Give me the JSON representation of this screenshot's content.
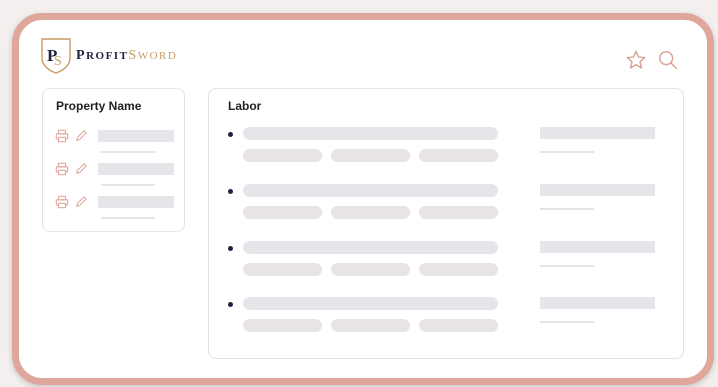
{
  "brand": {
    "logo_monogram": "PS",
    "name_part1": "PROFIT",
    "name_part2": "SWORD",
    "primary_color": "#1f2340",
    "accent_color": "#c79a62",
    "frame_color": "#dfa79b"
  },
  "header": {
    "icons": [
      "star-icon",
      "search-icon"
    ]
  },
  "property_panel": {
    "title": "Property Name",
    "rows": [
      {
        "icons": [
          "printer-icon",
          "pencil-icon"
        ]
      },
      {
        "icons": [
          "printer-icon",
          "pencil-icon"
        ]
      },
      {
        "icons": [
          "printer-icon",
          "pencil-icon"
        ]
      }
    ]
  },
  "labor_panel": {
    "title": "Labor",
    "items": [
      {
        "pills": 3
      },
      {
        "pills": 3
      },
      {
        "pills": 3
      },
      {
        "pills": 3
      }
    ]
  }
}
